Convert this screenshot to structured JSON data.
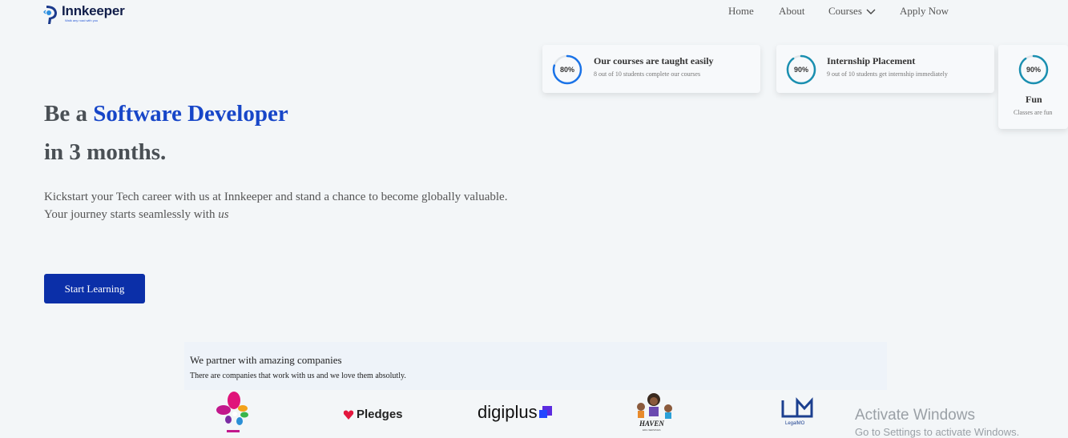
{
  "brand": {
    "name": "Innkeeper",
    "tagline": "Walk any road with you"
  },
  "nav": {
    "home": "Home",
    "about": "About",
    "courses": "Courses",
    "apply": "Apply Now"
  },
  "stats": [
    {
      "value": "80%",
      "percent": 80,
      "title": "Our courses are taught easily",
      "subtitle": "8 out of 10 students complete our courses"
    },
    {
      "value": "90%",
      "percent": 90,
      "title": "Internship Placement",
      "subtitle": "9 out of 10 students get internship immediately"
    },
    {
      "value": "90%",
      "percent": 90,
      "title": "Fun",
      "subtitle": "Classes are fun"
    }
  ],
  "hero": {
    "line1_prefix": "Be a",
    "line1_accent": "Software Developer",
    "line2": "in 3 months.",
    "desc_line1": "Kickstart your Tech career with us at Innkeeper and stand a chance to become globally valuable.",
    "desc_line2_prefix": "Your journey starts seamlessly with",
    "desc_line2_em": "us",
    "cta": "Start Learning"
  },
  "partners": {
    "title": "We partner with amazing companies",
    "subtitle": "There are companies that work with us and we love them absolutly.",
    "logos": [
      {
        "name": "flower-logo",
        "caption": ""
      },
      {
        "name": "pledges-logo",
        "text": "Pledges"
      },
      {
        "name": "digiplus-logo",
        "text": "digiplus"
      },
      {
        "name": "haven-logo",
        "text": "HAVEN",
        "caption": "EDU-SERVICES"
      },
      {
        "name": "legalmo-logo",
        "text": "LegalMO"
      }
    ]
  },
  "watermark": {
    "line1": "Activate Windows",
    "line2": "Go to Settings to activate Windows."
  },
  "colors": {
    "accent": "#1746c8",
    "cta": "#0b2fa8",
    "ring": "#1a73e8",
    "ring_track": "#e1e6ea",
    "background": "#f3f6f8"
  }
}
